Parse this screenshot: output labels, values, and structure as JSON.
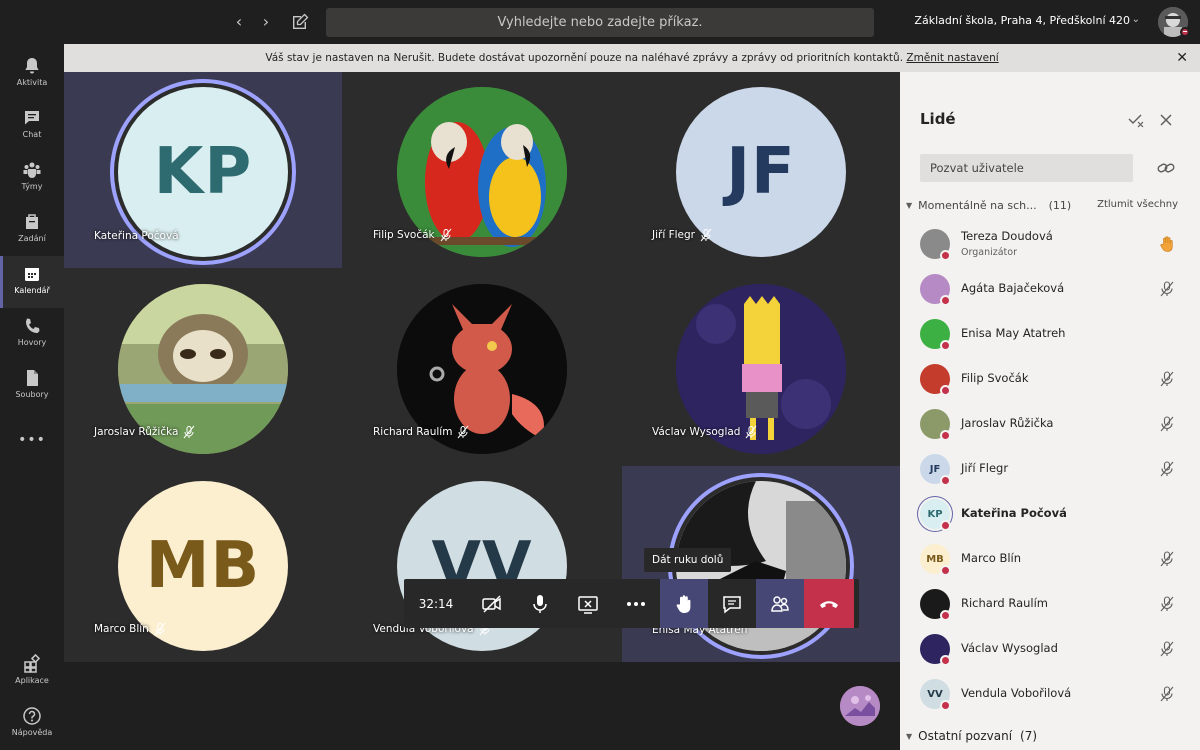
{
  "topbar": {
    "search_placeholder": "Vyhledejte nebo zadejte příkaz.",
    "org_name": "Základní škola, Praha 4, Předškolní 420"
  },
  "rail": {
    "items": [
      {
        "label": "Aktivita"
      },
      {
        "label": "Chat"
      },
      {
        "label": "Týmy"
      },
      {
        "label": "Zadání"
      },
      {
        "label": "Kalendář"
      },
      {
        "label": "Hovory"
      },
      {
        "label": "Soubory"
      },
      {
        "label": "Aplikace"
      },
      {
        "label": "Nápověda"
      }
    ],
    "more_label": "•••"
  },
  "banner": {
    "text": "Váš stav je nastaven na Nerušit. Budete dostávat upozornění pouze na naléhavé zprávy a zprávy od prioritních kontaktů.",
    "link": "Změnit nastavení"
  },
  "tiles": [
    {
      "name": "Kateřina Počová",
      "initials": "KP",
      "bg": "#d9eef0",
      "fg": "#2e6b70"
    },
    {
      "name": "Filip Svočák",
      "initials": "",
      "bg": "#4a8a3a",
      "fg": "#fff"
    },
    {
      "name": "Jiří Flegr",
      "initials": "JF",
      "bg": "#cbd8ea",
      "fg": "#243a5e"
    },
    {
      "name": "Jaroslav Růžička",
      "initials": "",
      "bg": "#8c9a6a",
      "fg": "#fff"
    },
    {
      "name": "Richard Raulím",
      "initials": "",
      "bg": "#101010",
      "fg": "#fff"
    },
    {
      "name": "Václav Wysoglad",
      "initials": "",
      "bg": "#2e2460",
      "fg": "#fff"
    },
    {
      "name": "Marco Blín",
      "initials": "MB",
      "bg": "#fcefd0",
      "fg": "#7a5a1a"
    },
    {
      "name": "Vendula Vobořilová",
      "initials": "VV",
      "bg": "#d0dde2",
      "fg": "#243a48"
    },
    {
      "name": "Enisa May Atatreh",
      "initials": "",
      "bg": "#9a9a9a",
      "fg": "#fff"
    }
  ],
  "controls": {
    "timer": "32:14",
    "tooltip": "Dát ruku dolů"
  },
  "people": {
    "title": "Lidé",
    "invite_placeholder": "Pozvat uživatele",
    "current_section": "Momentálně na sch...",
    "current_count": "(11)",
    "mute_all": "Ztlumit všechny",
    "other_section": "Ostatní pozvaní",
    "other_count": "(7)",
    "list": [
      {
        "name": "Tereza Doudová",
        "role": "Organizátor",
        "initials": "",
        "bg": "#8a8a8a",
        "fg": "#fff"
      },
      {
        "name": "Agáta Bajačeková",
        "initials": "",
        "bg": "#b68ac4",
        "fg": "#fff"
      },
      {
        "name": "Enisa May Atatreh",
        "initials": "",
        "bg": "#3cb043",
        "fg": "#fff"
      },
      {
        "name": "Filip Svočák",
        "initials": "",
        "bg": "#c43c2c",
        "fg": "#fff"
      },
      {
        "name": "Jaroslav Růžička",
        "initials": "",
        "bg": "#8c9a6a",
        "fg": "#fff"
      },
      {
        "name": "Jiří Flegr",
        "initials": "JF",
        "bg": "#cbd8ea",
        "fg": "#243a5e"
      },
      {
        "name": "Kateřina Počová",
        "initials": "KP",
        "bg": "#d9eef0",
        "fg": "#2e6b70"
      },
      {
        "name": "Marco Blín",
        "initials": "MB",
        "bg": "#fcefd0",
        "fg": "#7a5a1a"
      },
      {
        "name": "Richard Raulím",
        "initials": "",
        "bg": "#1a1a1a",
        "fg": "#fff"
      },
      {
        "name": "Václav Wysoglad",
        "initials": "",
        "bg": "#2e2460",
        "fg": "#fff"
      },
      {
        "name": "Vendula Vobořilová",
        "initials": "VV",
        "bg": "#d0dde2",
        "fg": "#243a48"
      }
    ]
  },
  "colors": {
    "accent": "#6264a7",
    "hangup": "#c4314b",
    "dnd": "#c4314b",
    "raise_hand": "#f2a33a"
  }
}
